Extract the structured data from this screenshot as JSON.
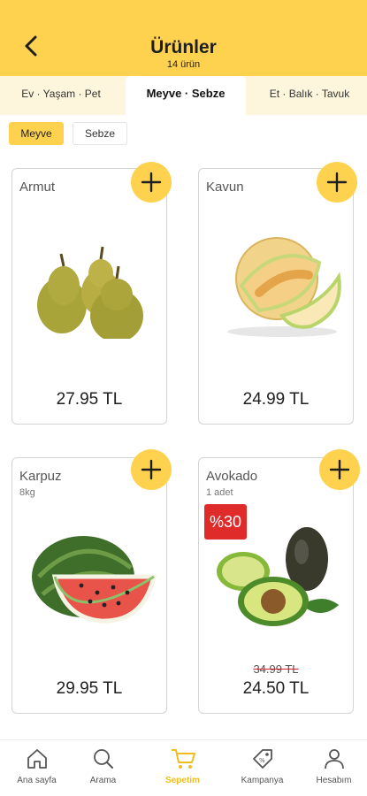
{
  "header": {
    "title": "Ürünler",
    "subtitle": "14 ürün"
  },
  "category_tabs": [
    {
      "label": "Ev · Yaşam · Pet",
      "active": false
    },
    {
      "label": "Meyve · Sebze",
      "active": true
    },
    {
      "label": "Et · Balık · Tavuk",
      "active": false
    }
  ],
  "filter_chips": [
    {
      "label": "Meyve",
      "active": true
    },
    {
      "label": "Sebze",
      "active": false
    }
  ],
  "products": [
    {
      "name": "Armut",
      "unit": "",
      "price": "27.95 TL",
      "old_price": "",
      "badge": "",
      "icon": "pear-image"
    },
    {
      "name": "Kavun",
      "unit": "",
      "price": "24.99 TL",
      "old_price": "",
      "badge": "",
      "icon": "melon-image"
    },
    {
      "name": "Karpuz",
      "unit": "8kg",
      "price": "29.95 TL",
      "old_price": "",
      "badge": "",
      "icon": "watermelon-image"
    },
    {
      "name": "Avokado",
      "unit": "1 adet",
      "price": "24.50 TL",
      "old_price": "34.99 TL",
      "badge": "%30",
      "icon": "avocado-image"
    }
  ],
  "bottom_nav": [
    {
      "label": "Ana sayfa",
      "icon": "home-icon",
      "active": false
    },
    {
      "label": "Arama",
      "icon": "search-icon",
      "active": false
    },
    {
      "label": "Sepetim",
      "icon": "cart-icon",
      "active": true
    },
    {
      "label": "Kampanya",
      "icon": "tag-icon",
      "active": false
    },
    {
      "label": "Hesabım",
      "icon": "user-icon",
      "active": false
    }
  ],
  "colors": {
    "accent": "#fed24f",
    "tab_bar": "#fef6dc",
    "discount_badge": "#e02b2b",
    "active_nav": "#f0bd1e"
  }
}
